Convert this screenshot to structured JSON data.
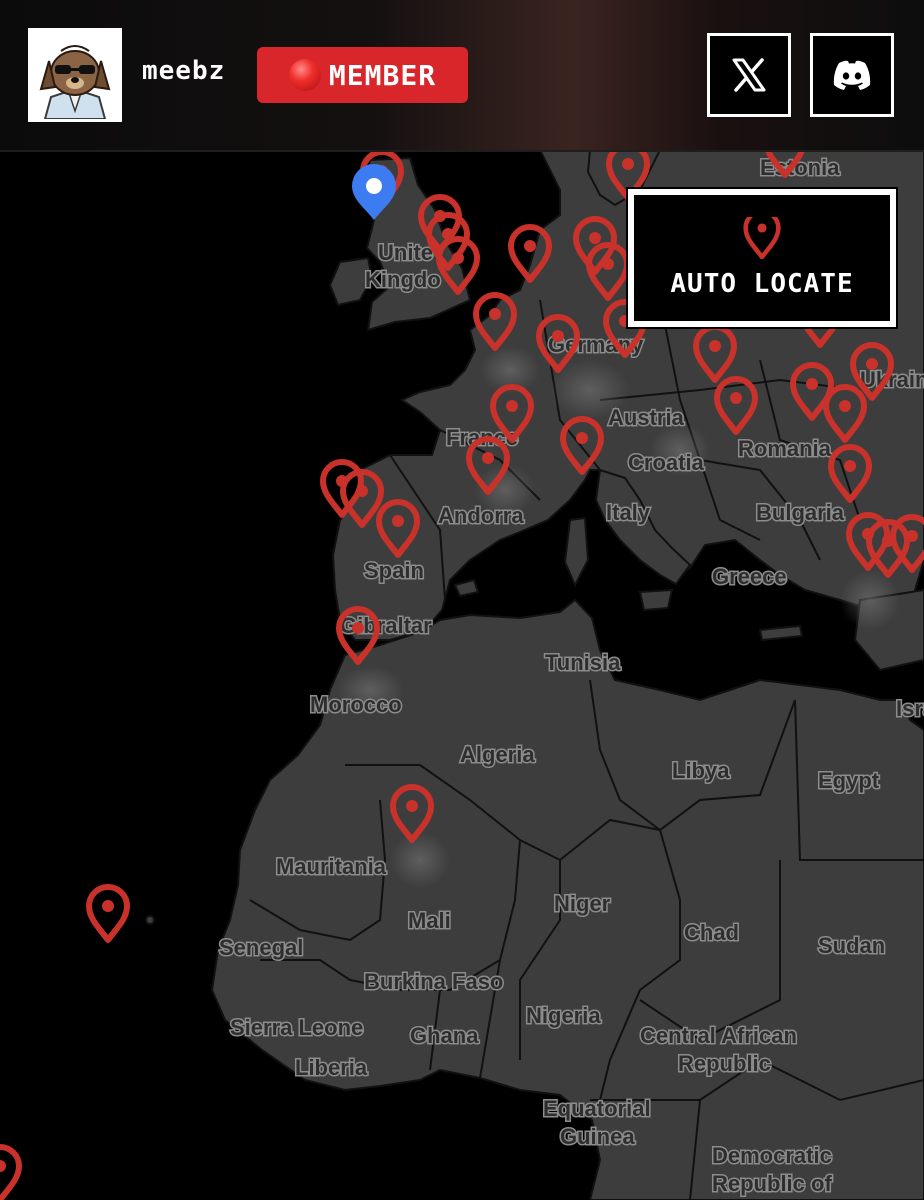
{
  "header": {
    "username": "meebz",
    "badge_label": "MEMBER",
    "badge_color": "#d8262a",
    "social": [
      {
        "name": "x",
        "icon": "x-logo-icon"
      },
      {
        "name": "discord",
        "icon": "discord-logo-icon"
      }
    ]
  },
  "auto_locate": {
    "label": "AUTO LOCATE",
    "icon": "map-pin-icon"
  },
  "map": {
    "land_color": "#3d3d3d",
    "water_color": "#000000",
    "border_color": "#111111",
    "pin_color": "#c9322a",
    "current_location_pin_color": "#3d7cf0",
    "labels": {
      "estonia": "Estonia",
      "uk": "United Kingdom",
      "germany": "Germany",
      "ukraine": "Ukraine",
      "france": "France",
      "austria": "Austria",
      "romania": "Romania",
      "croatia": "Croatia",
      "andorra": "Andorra",
      "italy": "Italy",
      "bulgaria": "Bulgaria",
      "spain": "Spain",
      "greece": "Greece",
      "gibraltar": "Gibraltar",
      "tunisia": "Tunisia",
      "morocco": "Morocco",
      "israel": "Israel",
      "algeria": "Algeria",
      "libya": "Libya",
      "egypt": "Egypt",
      "mauritania": "Mauritania",
      "niger": "Niger",
      "mali": "Mali",
      "chad": "Chad",
      "senegal": "Senegal",
      "sudan": "Sudan",
      "burkina_faso": "Burkina Faso",
      "sierra_leone": "Sierra Leone",
      "ghana": "Ghana",
      "nigeria": "Nigeria",
      "car_line1": "Central African",
      "car_line2": "Republic",
      "liberia": "Liberia",
      "eq_guinea_line1": "Equatorial",
      "eq_guinea_line2": "Guinea",
      "drc_line1": "Democratic",
      "drc_line2": "Republic of"
    }
  }
}
